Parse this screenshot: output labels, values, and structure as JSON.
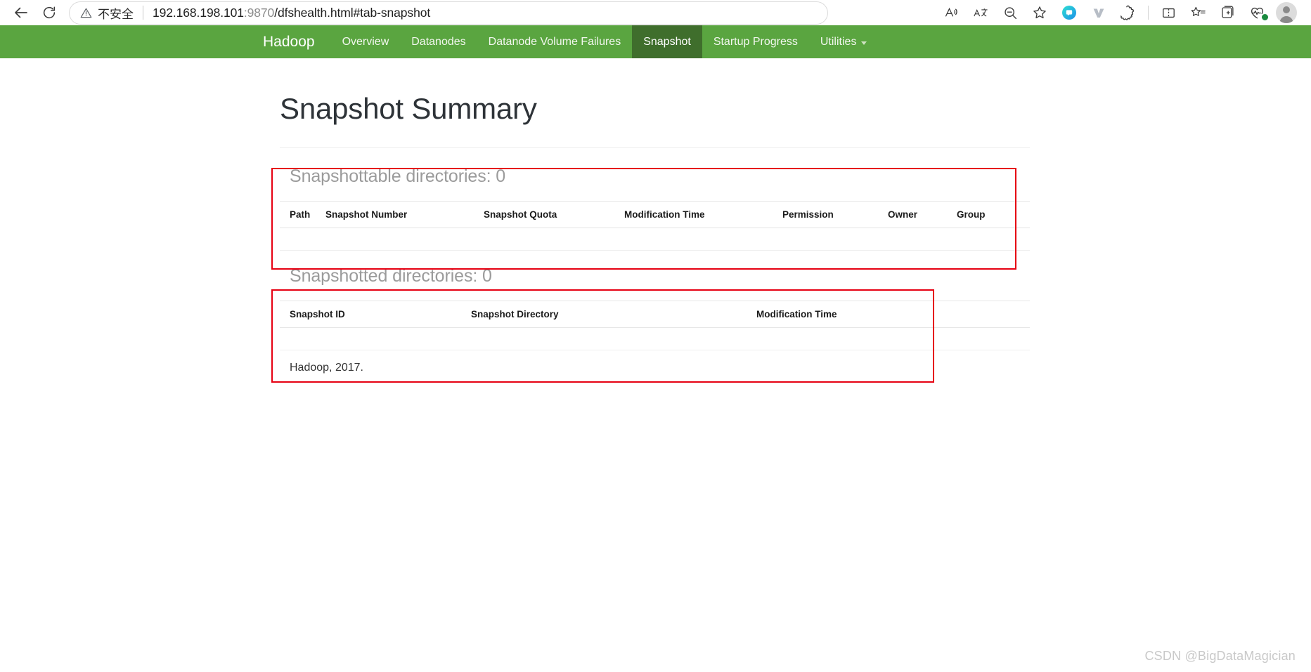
{
  "browser": {
    "back_label": "Back",
    "reload_label": "Refresh",
    "security_label": "不安全",
    "url_host": "192.168.198.101",
    "url_port": ":9870",
    "url_path": "/dfshealth.html#tab-snapshot",
    "url_full": "192.168.198.101:9870/dfshealth.html#tab-snapshot",
    "toolbar_icons": [
      "read-aloud-icon",
      "translate-icon",
      "zoom-out-icon",
      "favorite-star-icon",
      "extension-quark-icon",
      "extension-v-icon",
      "extension-puzzle-icon",
      "split-screen-icon",
      "favorites-list-icon",
      "collections-icon",
      "browser-essentials-icon",
      "profile-avatar-icon"
    ]
  },
  "navbar": {
    "brand": "Hadoop",
    "items": [
      {
        "label": "Overview",
        "active": false
      },
      {
        "label": "Datanodes",
        "active": false
      },
      {
        "label": "Datanode Volume Failures",
        "active": false
      },
      {
        "label": "Snapshot",
        "active": true
      },
      {
        "label": "Startup Progress",
        "active": false
      },
      {
        "label": "Utilities",
        "active": false,
        "dropdown": true
      }
    ]
  },
  "main": {
    "page_title": "Snapshot Summary",
    "snapshottable": {
      "heading": "Snapshottable directories: 0",
      "count": "0",
      "columns": [
        "Path",
        "Snapshot Number",
        "Snapshot Quota",
        "Modification Time",
        "Permission",
        "Owner",
        "Group"
      ],
      "rows": []
    },
    "snapshotted": {
      "heading": "Snapshotted directories: 0",
      "count": "0",
      "columns": [
        "Snapshot ID",
        "Snapshot Directory",
        "Modification Time"
      ],
      "rows": []
    },
    "footer": "Hadoop, 2017."
  },
  "annotations": {
    "accent_color": "#e60012",
    "boxes": [
      "snapshottable-table-highlight",
      "snapshotted-table-highlight"
    ]
  },
  "watermark": "CSDN @BigDataMagician",
  "colors": {
    "navbar_green": "#5aa540",
    "navbar_active_green": "#3f6e2c",
    "annotation_red": "#e60012",
    "heading_gray": "#9b9b9b"
  }
}
